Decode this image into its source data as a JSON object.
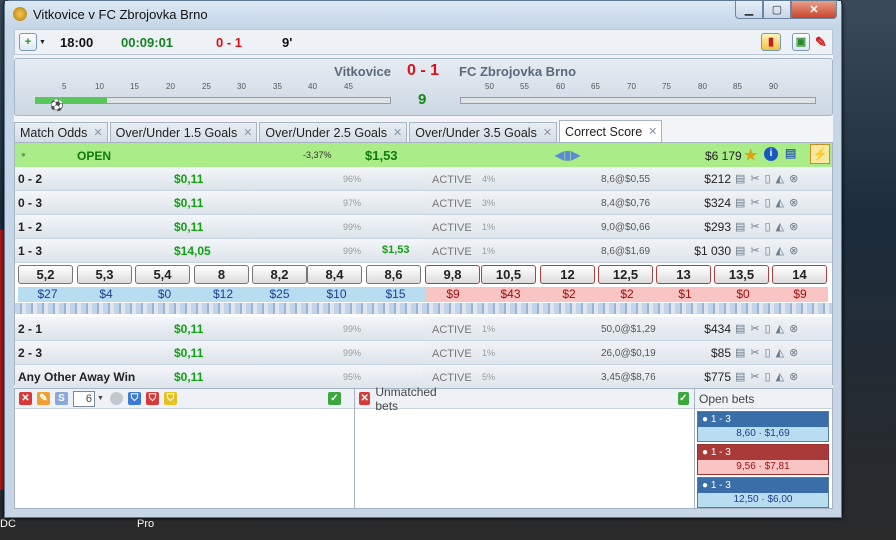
{
  "window": {
    "title": "Vitkovice v FC Zbrojovka Brno"
  },
  "desktop": {
    "labels": [
      "DC",
      "Pro"
    ]
  },
  "toolbar": {
    "start_time": "18:00",
    "elapsed": "00:09:01",
    "score": "0 - 1",
    "minute": "9'"
  },
  "scoreboard": {
    "home": "Vitkovice",
    "score": "0 - 1",
    "away": "FC Zbrojovka Brno",
    "minute": "9",
    "first_half_ticks": [
      "5",
      "10",
      "15",
      "20",
      "25",
      "30",
      "35",
      "40",
      "45"
    ],
    "second_half_ticks": [
      "50",
      "55",
      "60",
      "65",
      "70",
      "75",
      "80",
      "85",
      "90"
    ],
    "first_half_progress": 0.2
  },
  "tabs": [
    {
      "label": "Match Odds"
    },
    {
      "label": "Over/Under 1.5 Goals"
    },
    {
      "label": "Over/Under 2.5 Goals"
    },
    {
      "label": "Over/Under 3.5 Goals"
    },
    {
      "label": "Correct Score",
      "active": true
    }
  ],
  "status_row": {
    "state": "OPEN",
    "percent": "-3,37%",
    "total": "$1,53",
    "volume": "$6 179"
  },
  "runners": [
    {
      "name": "0 - 2",
      "profit": "$0,11",
      "pct": "96%",
      "status": "ACTIVE",
      "spread": "4%",
      "limits": "8,6@$0,55",
      "volume": "$212"
    },
    {
      "name": "0 - 3",
      "profit": "$0,11",
      "pct": "97%",
      "status": "ACTIVE",
      "spread": "3%",
      "limits": "8,4@$0,76",
      "volume": "$324"
    },
    {
      "name": "1 - 2",
      "profit": "$0,11",
      "pct": "99%",
      "status": "ACTIVE",
      "spread": "1%",
      "limits": "9,0@$0,66",
      "volume": "$293"
    },
    {
      "name": "1 - 3",
      "profit": "$14,05",
      "pct": "99%",
      "selected_amount": "$1,53",
      "status": "ACTIVE",
      "spread": "1%",
      "limits": "8,6@$1,69",
      "volume": "$1 030"
    },
    {
      "name": "2 - 1",
      "profit": "$0,11",
      "pct": "99%",
      "status": "ACTIVE",
      "spread": "1%",
      "limits": "50,0@$1,29",
      "volume": "$434"
    },
    {
      "name": "2 - 3",
      "profit": "$0,11",
      "pct": "99%",
      "status": "ACTIVE",
      "spread": "1%",
      "limits": "26,0@$0,19",
      "volume": "$85"
    },
    {
      "name": "Any Other Away Win",
      "profit": "$0,11",
      "pct": "95%",
      "status": "ACTIVE",
      "spread": "5%",
      "limits": "3,45@$8,76",
      "volume": "$775"
    }
  ],
  "ladder": {
    "back": [
      {
        "odds": "5,2",
        "amt": "$27"
      },
      {
        "odds": "5,3",
        "amt": "$4"
      },
      {
        "odds": "5,4",
        "amt": "$0"
      },
      {
        "odds": "8",
        "amt": "$12"
      },
      {
        "odds": "8,2",
        "amt": "$25"
      },
      {
        "odds": "8,4",
        "amt": "$10"
      },
      {
        "odds": "8,6",
        "amt": "$15"
      }
    ],
    "lay": [
      {
        "odds": "9,8",
        "amt": "$9"
      },
      {
        "odds": "10,5",
        "amt": "$43"
      },
      {
        "odds": "12",
        "amt": "$2"
      },
      {
        "odds": "12,5",
        "amt": "$2"
      },
      {
        "odds": "13",
        "amt": "$1"
      },
      {
        "odds": "13,5",
        "amt": "$0"
      },
      {
        "odds": "14",
        "amt": "$9"
      }
    ]
  },
  "bottom": {
    "stake_value": "6",
    "unmatched_label": "Unmatched bets",
    "open_label": "Open bets",
    "open_bets": [
      {
        "selection": "1 - 3",
        "odds": "8,60",
        "stake": "$1,69",
        "side": "back"
      },
      {
        "selection": "1 - 3",
        "odds": "9,56",
        "stake": "$7,81",
        "side": "lay"
      },
      {
        "selection": "1 - 3",
        "odds": "12,50",
        "stake": "$6,00",
        "side": "back"
      }
    ]
  },
  "colors": {
    "back": "#b8dcf0",
    "lay": "#f8c4c4",
    "profit": "#14a014",
    "score": "#e01010",
    "open": "#a9ec88"
  }
}
